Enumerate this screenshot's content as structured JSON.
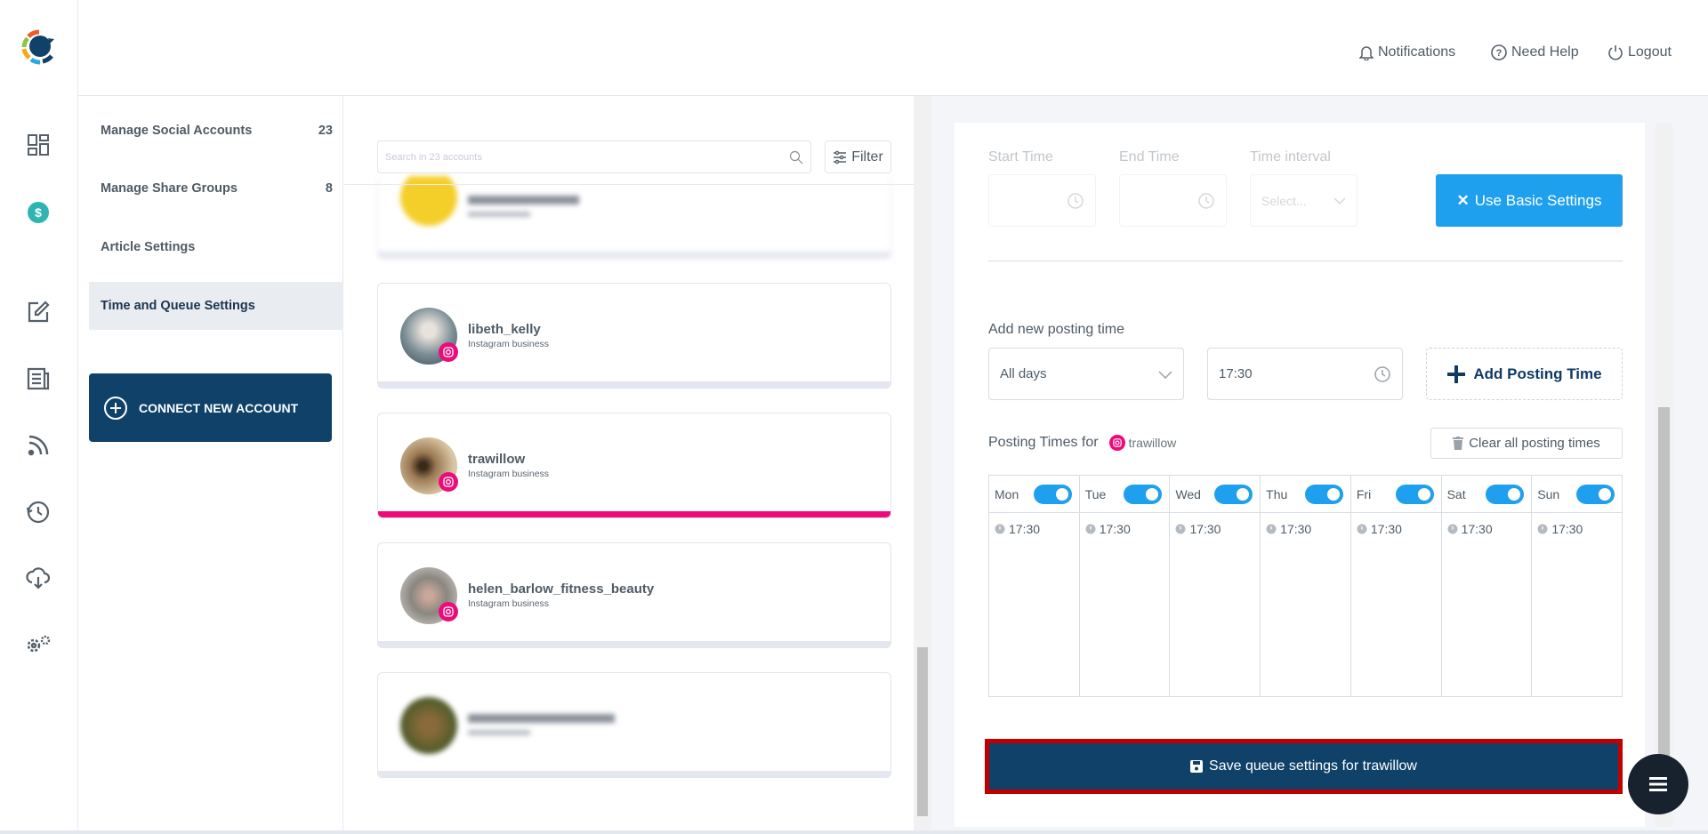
{
  "header": {
    "notifications": "Notifications",
    "help": "Need Help",
    "logout": "Logout"
  },
  "iconbar": {
    "items": [
      "dashboard-icon",
      "billing-icon",
      "compose-icon",
      "articles-icon",
      "rss-icon",
      "schedule-icon",
      "cloud-download-icon",
      "settings-icon"
    ]
  },
  "submenu": {
    "items": [
      {
        "label": "Manage Social Accounts",
        "count": "23"
      },
      {
        "label": "Manage Share Groups",
        "count": "8"
      },
      {
        "label": "Article Settings",
        "count": ""
      },
      {
        "label": "Time and Queue Settings",
        "count": "",
        "active": true
      }
    ],
    "connect": "CONNECT NEW ACCOUNT"
  },
  "accounts": {
    "search_placeholder": "Search in 23 accounts",
    "filter": "Filter",
    "items": [
      {
        "name": "libeth_kelly",
        "type": "Instagram business"
      },
      {
        "name": "trawillow",
        "type": "Instagram business",
        "selected": true
      },
      {
        "name": "helen_barlow_fitness_beauty",
        "type": "Instagram business"
      }
    ]
  },
  "settings": {
    "start_time": "Start Time",
    "end_time": "End Time",
    "time_interval": "Time interval",
    "interval_placeholder": "Select...",
    "use_basic": "Use Basic Settings",
    "add_new": "Add new posting time",
    "day_select": "All days",
    "time_value": "17:30",
    "add_button": "Add Posting Time",
    "posting_for": "Posting Times for",
    "account": "trawillow",
    "clear_all": "Clear all posting times",
    "days": [
      {
        "day": "Mon",
        "enabled": true,
        "time": "17:30"
      },
      {
        "day": "Tue",
        "enabled": true,
        "time": "17:30"
      },
      {
        "day": "Wed",
        "enabled": true,
        "time": "17:30"
      },
      {
        "day": "Thu",
        "enabled": true,
        "time": "17:30"
      },
      {
        "day": "Fri",
        "enabled": true,
        "time": "17:30"
      },
      {
        "day": "Sat",
        "enabled": true,
        "time": "17:30"
      },
      {
        "day": "Sun",
        "enabled": true,
        "time": "17:30"
      }
    ],
    "save": "Save queue settings for trawillow"
  },
  "colors": {
    "primary": "#0f4169",
    "accent": "#1fa0ee",
    "instagram": "#ee0a7a",
    "danger_outline": "#c00000"
  }
}
